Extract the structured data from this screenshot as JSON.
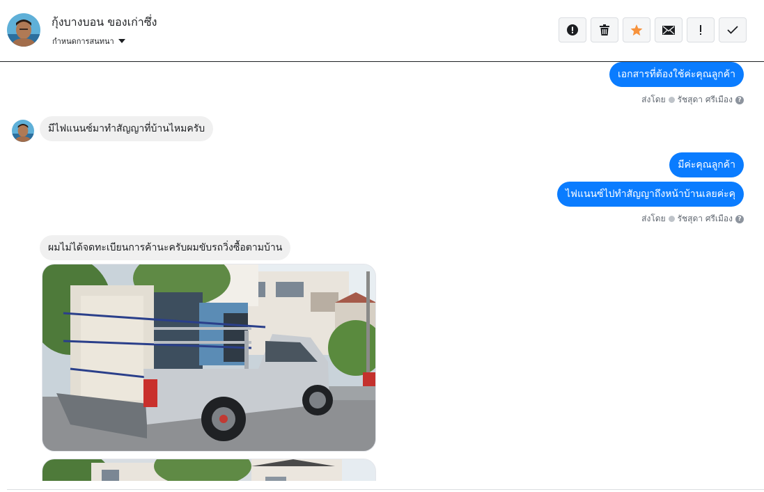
{
  "header": {
    "contact_name": "กุ้งบางบอน ของเก่าซึ่ง",
    "assign_label": "กำหนดการสนทนา",
    "toolbar": [
      {
        "name": "spam-button",
        "icon": "alert-circle-icon"
      },
      {
        "name": "delete-button",
        "icon": "trash-icon"
      },
      {
        "name": "star-button",
        "icon": "star-icon"
      },
      {
        "name": "mark-unread-button",
        "icon": "envelope-icon"
      },
      {
        "name": "follow-up-button",
        "icon": "exclamation-icon"
      },
      {
        "name": "mark-done-button",
        "icon": "checkmark-icon"
      }
    ]
  },
  "messages": {
    "m1_text": "เอกสารที่ต้องใช้ค่ะคุณลูกค้า",
    "m1_sent_prefix": "ส่งโดย",
    "m1_sender": "รัชสุดา ศรีเมือง",
    "m2_text": "มีไฟแนนซ์มาทำสัญญาที่บ้านไหมครับ",
    "m3_text": "มีค่ะคุณลูกค้า",
    "m4_text": "ไฟแนนซ์ไปทำสัญญาถึงหน้าบ้านเลยค่ะคุ",
    "m4_sent_prefix": "ส่งโดย",
    "m4_sender": "รัชสุดา ศรีเมือง",
    "m5_text": "ผมไม่ได้จดทะเบียนการค้านะครับผมขับรถวิ่งซื้อตามบ้าน"
  },
  "colors": {
    "outgoing_bubble": "#0a7cff",
    "incoming_bubble": "#f0f0f0",
    "star_accent": "#f7923b"
  }
}
